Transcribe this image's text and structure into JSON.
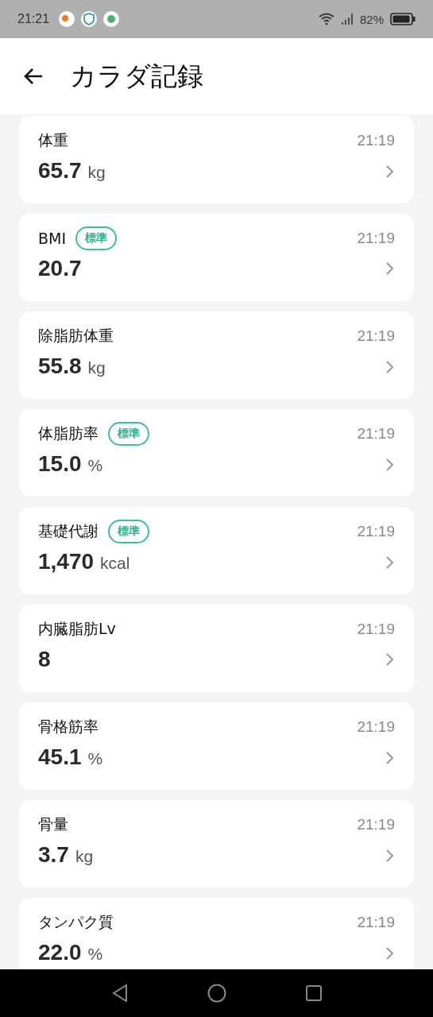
{
  "status_bar": {
    "time": "21:21",
    "battery": "82%"
  },
  "header": {
    "title": "カラダ記録"
  },
  "records": [
    {
      "label": "体重",
      "value": "65.7",
      "unit": "kg",
      "time": "21:19"
    },
    {
      "label": "BMI",
      "badge": "標準",
      "value": "20.7",
      "time": "21:19"
    },
    {
      "label": "除脂肪体重",
      "value": "55.8",
      "unit": "kg",
      "time": "21:19"
    },
    {
      "label": "体脂肪率",
      "badge": "標準",
      "value": "15.0",
      "unit": "%",
      "time": "21:19"
    },
    {
      "label": "基礎代謝",
      "badge": "標準",
      "value": "1,470",
      "unit": "kcal",
      "time": "21:19"
    },
    {
      "label": "内臓脂肪Lv",
      "value": "8",
      "time": "21:19"
    },
    {
      "label": "骨格筋率",
      "value": "45.1",
      "unit": "%",
      "time": "21:19"
    },
    {
      "label": "骨量",
      "value": "3.7",
      "unit": "kg",
      "time": "21:19"
    },
    {
      "label": "タンパク質",
      "value": "22.0",
      "unit": "%",
      "time": "21:19"
    }
  ]
}
